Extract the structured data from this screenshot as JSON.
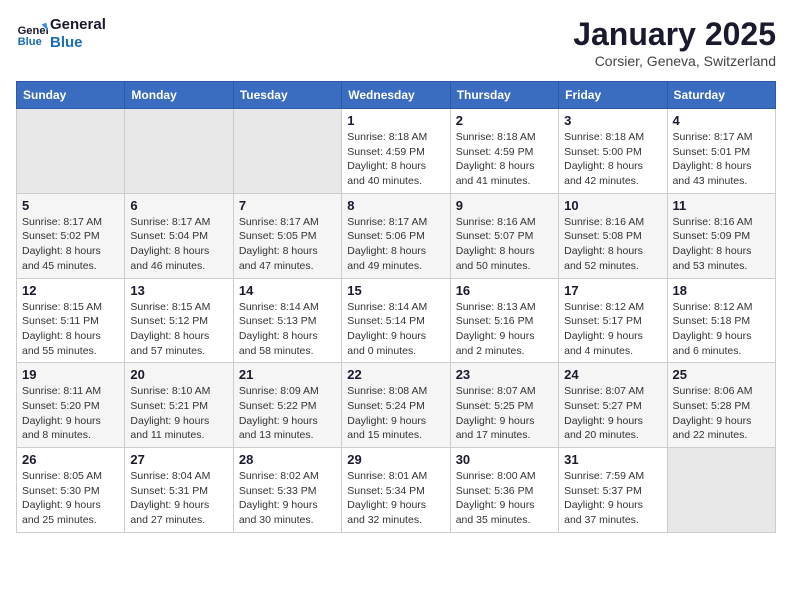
{
  "logo": {
    "line1": "General",
    "line2": "Blue"
  },
  "title": "January 2025",
  "subtitle": "Corsier, Geneva, Switzerland",
  "headers": [
    "Sunday",
    "Monday",
    "Tuesday",
    "Wednesday",
    "Thursday",
    "Friday",
    "Saturday"
  ],
  "weeks": [
    [
      {
        "day": "",
        "sunrise": "",
        "sunset": "",
        "daylight": ""
      },
      {
        "day": "",
        "sunrise": "",
        "sunset": "",
        "daylight": ""
      },
      {
        "day": "",
        "sunrise": "",
        "sunset": "",
        "daylight": ""
      },
      {
        "day": "1",
        "sunrise": "Sunrise: 8:18 AM",
        "sunset": "Sunset: 4:59 PM",
        "daylight": "Daylight: 8 hours and 40 minutes."
      },
      {
        "day": "2",
        "sunrise": "Sunrise: 8:18 AM",
        "sunset": "Sunset: 4:59 PM",
        "daylight": "Daylight: 8 hours and 41 minutes."
      },
      {
        "day": "3",
        "sunrise": "Sunrise: 8:18 AM",
        "sunset": "Sunset: 5:00 PM",
        "daylight": "Daylight: 8 hours and 42 minutes."
      },
      {
        "day": "4",
        "sunrise": "Sunrise: 8:17 AM",
        "sunset": "Sunset: 5:01 PM",
        "daylight": "Daylight: 8 hours and 43 minutes."
      }
    ],
    [
      {
        "day": "5",
        "sunrise": "Sunrise: 8:17 AM",
        "sunset": "Sunset: 5:02 PM",
        "daylight": "Daylight: 8 hours and 45 minutes."
      },
      {
        "day": "6",
        "sunrise": "Sunrise: 8:17 AM",
        "sunset": "Sunset: 5:04 PM",
        "daylight": "Daylight: 8 hours and 46 minutes."
      },
      {
        "day": "7",
        "sunrise": "Sunrise: 8:17 AM",
        "sunset": "Sunset: 5:05 PM",
        "daylight": "Daylight: 8 hours and 47 minutes."
      },
      {
        "day": "8",
        "sunrise": "Sunrise: 8:17 AM",
        "sunset": "Sunset: 5:06 PM",
        "daylight": "Daylight: 8 hours and 49 minutes."
      },
      {
        "day": "9",
        "sunrise": "Sunrise: 8:16 AM",
        "sunset": "Sunset: 5:07 PM",
        "daylight": "Daylight: 8 hours and 50 minutes."
      },
      {
        "day": "10",
        "sunrise": "Sunrise: 8:16 AM",
        "sunset": "Sunset: 5:08 PM",
        "daylight": "Daylight: 8 hours and 52 minutes."
      },
      {
        "day": "11",
        "sunrise": "Sunrise: 8:16 AM",
        "sunset": "Sunset: 5:09 PM",
        "daylight": "Daylight: 8 hours and 53 minutes."
      }
    ],
    [
      {
        "day": "12",
        "sunrise": "Sunrise: 8:15 AM",
        "sunset": "Sunset: 5:11 PM",
        "daylight": "Daylight: 8 hours and 55 minutes."
      },
      {
        "day": "13",
        "sunrise": "Sunrise: 8:15 AM",
        "sunset": "Sunset: 5:12 PM",
        "daylight": "Daylight: 8 hours and 57 minutes."
      },
      {
        "day": "14",
        "sunrise": "Sunrise: 8:14 AM",
        "sunset": "Sunset: 5:13 PM",
        "daylight": "Daylight: 8 hours and 58 minutes."
      },
      {
        "day": "15",
        "sunrise": "Sunrise: 8:14 AM",
        "sunset": "Sunset: 5:14 PM",
        "daylight": "Daylight: 9 hours and 0 minutes."
      },
      {
        "day": "16",
        "sunrise": "Sunrise: 8:13 AM",
        "sunset": "Sunset: 5:16 PM",
        "daylight": "Daylight: 9 hours and 2 minutes."
      },
      {
        "day": "17",
        "sunrise": "Sunrise: 8:12 AM",
        "sunset": "Sunset: 5:17 PM",
        "daylight": "Daylight: 9 hours and 4 minutes."
      },
      {
        "day": "18",
        "sunrise": "Sunrise: 8:12 AM",
        "sunset": "Sunset: 5:18 PM",
        "daylight": "Daylight: 9 hours and 6 minutes."
      }
    ],
    [
      {
        "day": "19",
        "sunrise": "Sunrise: 8:11 AM",
        "sunset": "Sunset: 5:20 PM",
        "daylight": "Daylight: 9 hours and 8 minutes."
      },
      {
        "day": "20",
        "sunrise": "Sunrise: 8:10 AM",
        "sunset": "Sunset: 5:21 PM",
        "daylight": "Daylight: 9 hours and 11 minutes."
      },
      {
        "day": "21",
        "sunrise": "Sunrise: 8:09 AM",
        "sunset": "Sunset: 5:22 PM",
        "daylight": "Daylight: 9 hours and 13 minutes."
      },
      {
        "day": "22",
        "sunrise": "Sunrise: 8:08 AM",
        "sunset": "Sunset: 5:24 PM",
        "daylight": "Daylight: 9 hours and 15 minutes."
      },
      {
        "day": "23",
        "sunrise": "Sunrise: 8:07 AM",
        "sunset": "Sunset: 5:25 PM",
        "daylight": "Daylight: 9 hours and 17 minutes."
      },
      {
        "day": "24",
        "sunrise": "Sunrise: 8:07 AM",
        "sunset": "Sunset: 5:27 PM",
        "daylight": "Daylight: 9 hours and 20 minutes."
      },
      {
        "day": "25",
        "sunrise": "Sunrise: 8:06 AM",
        "sunset": "Sunset: 5:28 PM",
        "daylight": "Daylight: 9 hours and 22 minutes."
      }
    ],
    [
      {
        "day": "26",
        "sunrise": "Sunrise: 8:05 AM",
        "sunset": "Sunset: 5:30 PM",
        "daylight": "Daylight: 9 hours and 25 minutes."
      },
      {
        "day": "27",
        "sunrise": "Sunrise: 8:04 AM",
        "sunset": "Sunset: 5:31 PM",
        "daylight": "Daylight: 9 hours and 27 minutes."
      },
      {
        "day": "28",
        "sunrise": "Sunrise: 8:02 AM",
        "sunset": "Sunset: 5:33 PM",
        "daylight": "Daylight: 9 hours and 30 minutes."
      },
      {
        "day": "29",
        "sunrise": "Sunrise: 8:01 AM",
        "sunset": "Sunset: 5:34 PM",
        "daylight": "Daylight: 9 hours and 32 minutes."
      },
      {
        "day": "30",
        "sunrise": "Sunrise: 8:00 AM",
        "sunset": "Sunset: 5:36 PM",
        "daylight": "Daylight: 9 hours and 35 minutes."
      },
      {
        "day": "31",
        "sunrise": "Sunrise: 7:59 AM",
        "sunset": "Sunset: 5:37 PM",
        "daylight": "Daylight: 9 hours and 37 minutes."
      },
      {
        "day": "",
        "sunrise": "",
        "sunset": "",
        "daylight": ""
      }
    ]
  ]
}
